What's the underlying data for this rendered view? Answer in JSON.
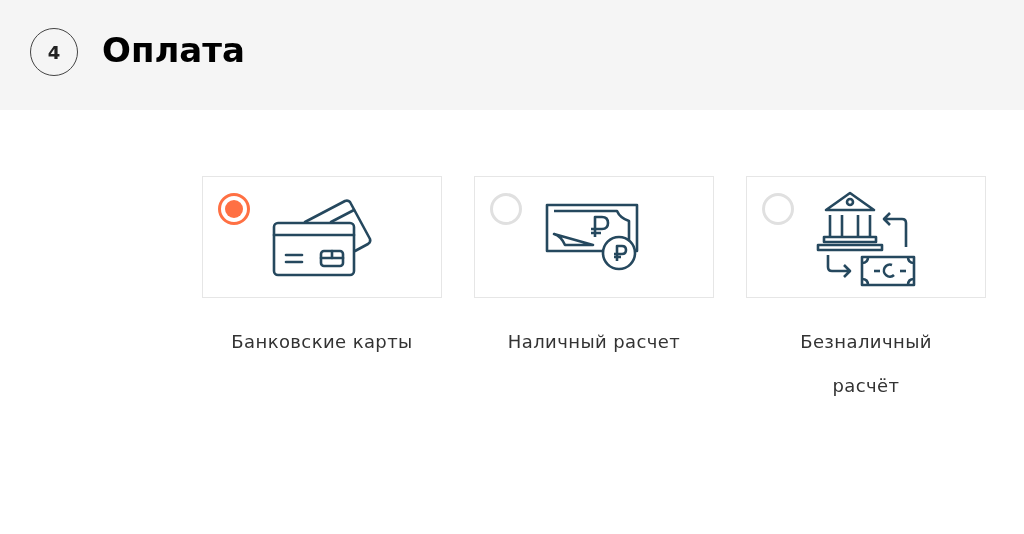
{
  "header": {
    "step": "4",
    "title": "Оплата"
  },
  "options": [
    {
      "kind": "card",
      "label": "Банковские карты",
      "selected": true
    },
    {
      "kind": "cash",
      "label": "Наличный расчет",
      "selected": false
    },
    {
      "kind": "transfer",
      "label": "Безналичный расчёт",
      "selected": false
    }
  ]
}
